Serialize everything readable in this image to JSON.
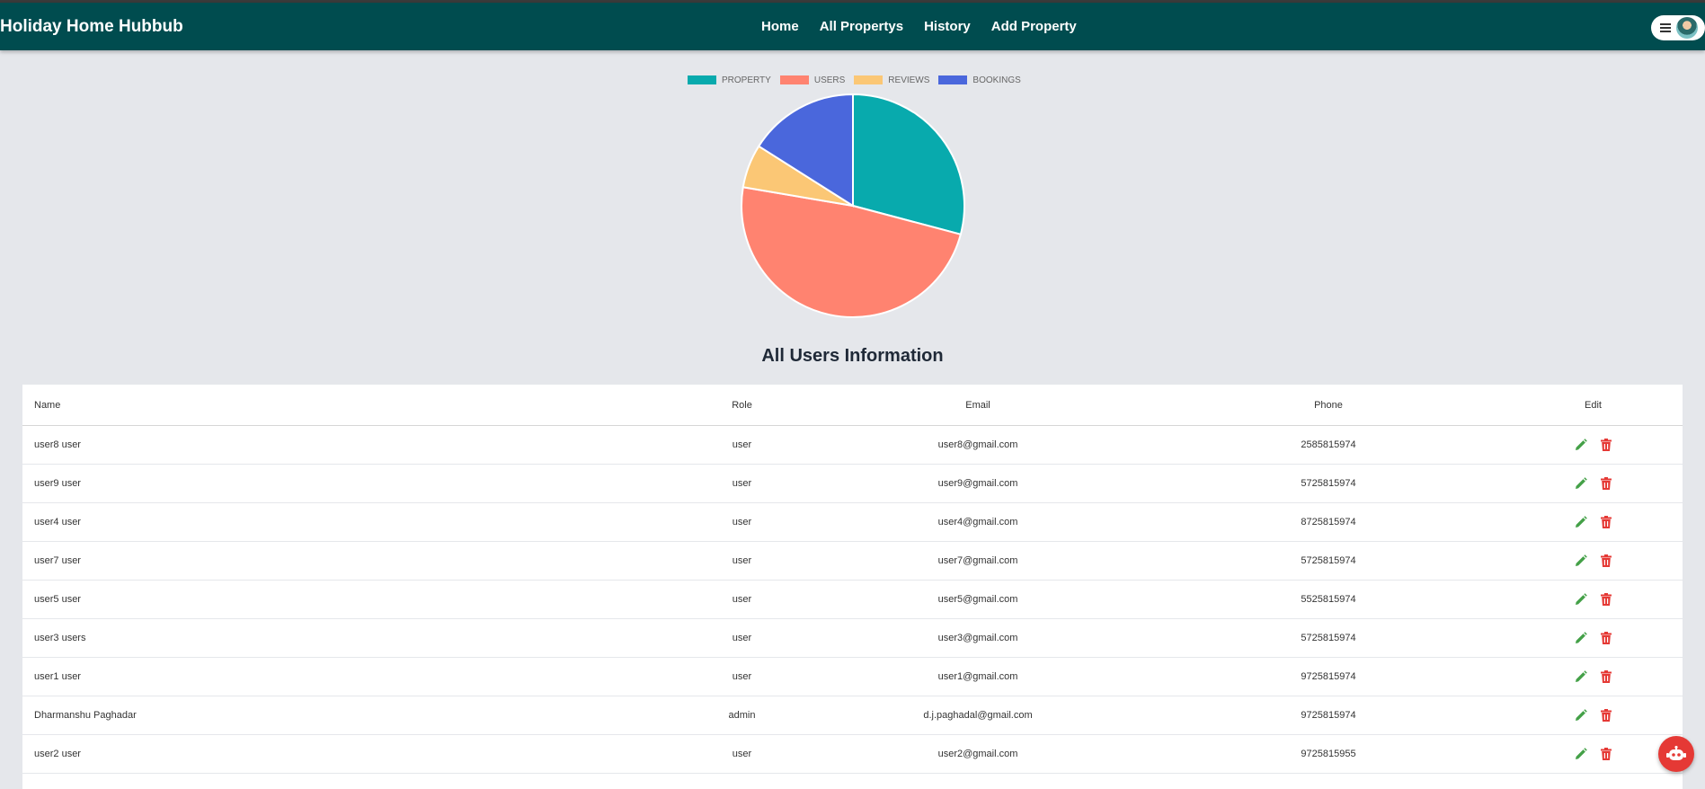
{
  "app": {
    "brand": "Holiday Home Hubbub"
  },
  "nav": {
    "links": [
      "Home",
      "All Propertys",
      "History",
      "Add Property"
    ]
  },
  "chart_data": {
    "type": "pie",
    "categories": [
      "PROPERTY",
      "USERS",
      "REVIEWS",
      "BOOKINGS"
    ],
    "values": [
      6,
      10,
      1.3,
      3.3
    ],
    "colors": [
      "#08aaad",
      "#ff8370",
      "#fbc775",
      "#4a67dc"
    ],
    "legend_position": "top"
  },
  "section": {
    "title": "All Users Information"
  },
  "table": {
    "columns": [
      "Name",
      "Role",
      "Email",
      "Phone",
      "Edit"
    ],
    "rows": [
      {
        "name": "user8 user",
        "role": "user",
        "email": "user8@gmail.com",
        "phone": "2585815974"
      },
      {
        "name": "user9 user",
        "role": "user",
        "email": "user9@gmail.com",
        "phone": "5725815974"
      },
      {
        "name": "user4 user",
        "role": "user",
        "email": "user4@gmail.com",
        "phone": "8725815974"
      },
      {
        "name": "user7 user",
        "role": "user",
        "email": "user7@gmail.com",
        "phone": "5725815974"
      },
      {
        "name": "user5 user",
        "role": "user",
        "email": "user5@gmail.com",
        "phone": "5525815974"
      },
      {
        "name": "user3 users",
        "role": "user",
        "email": "user3@gmail.com",
        "phone": "5725815974"
      },
      {
        "name": "user1 user",
        "role": "user",
        "email": "user1@gmail.com",
        "phone": "9725815974"
      },
      {
        "name": "Dharmanshu Paghadar",
        "role": "admin",
        "email": "d.j.paghadal@gmail.com",
        "phone": "9725815974"
      },
      {
        "name": "user2 user",
        "role": "user",
        "email": "user2@gmail.com",
        "phone": "9725815955"
      }
    ]
  },
  "icons": {
    "edit": "pencil-icon",
    "delete": "trash-icon",
    "menu": "hamburger-icon",
    "chatbot": "robot-icon",
    "edit_color": "#43a047",
    "delete_color": "#e53935"
  },
  "theme": {
    "navbar": "#004c4f",
    "background": "#e5e7eb"
  }
}
